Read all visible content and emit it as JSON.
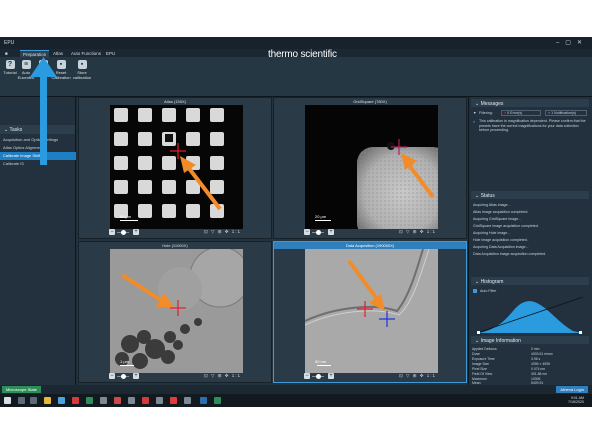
{
  "app": {
    "title": "EPU"
  },
  "ribbon": {
    "tabs": [
      "Preparation",
      "Atlas",
      "Auto Functions",
      "EPU"
    ],
    "brand": "thermo scientific",
    "tools": [
      {
        "label": "Tutorial",
        "icon": "question-icon"
      },
      {
        "label": "Auto Eucentric",
        "icon": "eucentric-icon"
      },
      {
        "label": "Acquire",
        "icon": "camera-icon"
      },
      {
        "label": "Reset Calibration",
        "icon": "reset-icon"
      },
      {
        "label": "Store calibration",
        "icon": "store-icon"
      }
    ]
  },
  "tasks": {
    "header": "Tasks",
    "items": [
      "Acquisition and Optics Settings",
      "Atlas Optics Alignment",
      "Calibrate Image Shifts",
      "Calibrate IS"
    ],
    "selected_index": 2
  },
  "viewports": [
    {
      "title": "Atlas (155X)",
      "scale": "50 µm",
      "selected": false
    },
    {
      "title": "GridSquare (780X)",
      "scale": "20 µm",
      "selected": false
    },
    {
      "title": "Hole (11000X)",
      "scale": "1 µm",
      "selected": false
    },
    {
      "title": "Data Acquisition (190000X)",
      "scale": "50 nm",
      "selected": true
    }
  ],
  "viewport_tools": "⊡ ▽ ⊞ ✥ 1:1",
  "messages": {
    "header": "Messages",
    "filtering_label": "Filtering:",
    "error_filter": "0 Error(s)",
    "notification_filter": "1 Notification(s)",
    "text": "This calibration is magnification dependent. Please confirm that the presets have the correct magnifications for your data collection before proceeding."
  },
  "status_panel": {
    "header": "Status",
    "lines": [
      "Acquiring Atlas image...",
      "Atlas image acquisition completed.",
      "Acquiring GridSquare image...",
      "GridSquare image acquisition completed.",
      "Acquiring Hole image...",
      "Hole image acquisition completed.",
      "Acquiring Data Acquisition image...",
      "Data Acquisition image acquisition completed."
    ]
  },
  "histogram": {
    "header": "Histogram",
    "auto_filter_label": "Auto Filter",
    "auto_filter_checked": true
  },
  "image_info": {
    "header": "Image Information",
    "rows": [
      {
        "label": "Applied Defocus",
        "value": "0 mm"
      },
      {
        "label": "Dose",
        "value": "4003.61 e/nm²"
      },
      {
        "label": "Exposure Time",
        "value": "3.96 s"
      },
      {
        "label": "Image Size",
        "value": "4096 × 4096"
      },
      {
        "label": "Pixel Size",
        "value": "0.074 nm"
      },
      {
        "label": "Field Of View",
        "value": "301.88 nm"
      },
      {
        "label": "Maximum",
        "value": "10305"
      },
      {
        "label": "Mean",
        "value": "5409.91"
      },
      {
        "label": "Minimum",
        "value": "2171"
      }
    ]
  },
  "statusbar": {
    "microscope_state": "Microscope State",
    "login": "Athena Login"
  },
  "clock": {
    "time": "9:01 AM",
    "date": "7/16/2020"
  },
  "colors": {
    "accent": "#1f7fc4",
    "arrow": "#f28c28",
    "marker_red": "#e0202a",
    "marker_blue": "#2030e0"
  }
}
